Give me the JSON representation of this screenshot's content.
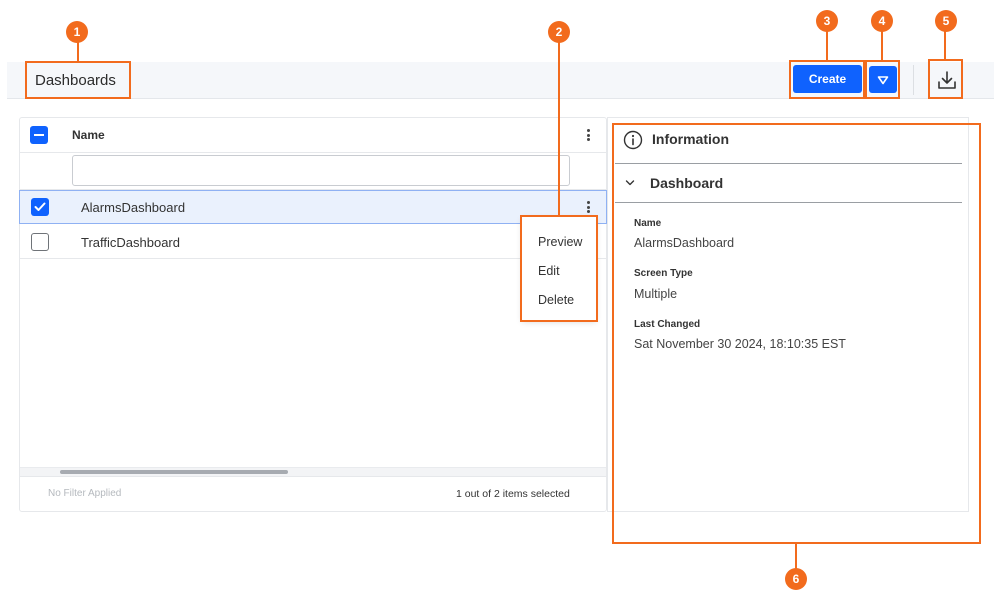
{
  "header": {
    "title": "Dashboards",
    "create_label": "Create"
  },
  "table": {
    "column_name": "Name",
    "filter_placeholder": "",
    "rows": [
      {
        "label": "AlarmsDashboard",
        "checked": true
      },
      {
        "label": "TrafficDashboard",
        "checked": false
      }
    ],
    "filter_status": "No Filter Applied",
    "selection_count": "1 out of 2 items selected"
  },
  "context_menu": {
    "items": [
      "Preview",
      "Edit",
      "Delete"
    ]
  },
  "info_panel": {
    "title": "Information",
    "section_title": "Dashboard",
    "properties": [
      {
        "label": "Name",
        "value": "AlarmsDashboard"
      },
      {
        "label": "Screen Type",
        "value": "Multiple"
      },
      {
        "label": "Last Changed",
        "value": "Sat November 30 2024, 18:10:35 EST"
      }
    ]
  },
  "annotations": {
    "badges": [
      "1",
      "2",
      "3",
      "4",
      "5",
      "6"
    ],
    "color": "#f26b1d"
  },
  "colors": {
    "primary": "#0f62fe",
    "selected_row": "#eaf1fd"
  }
}
